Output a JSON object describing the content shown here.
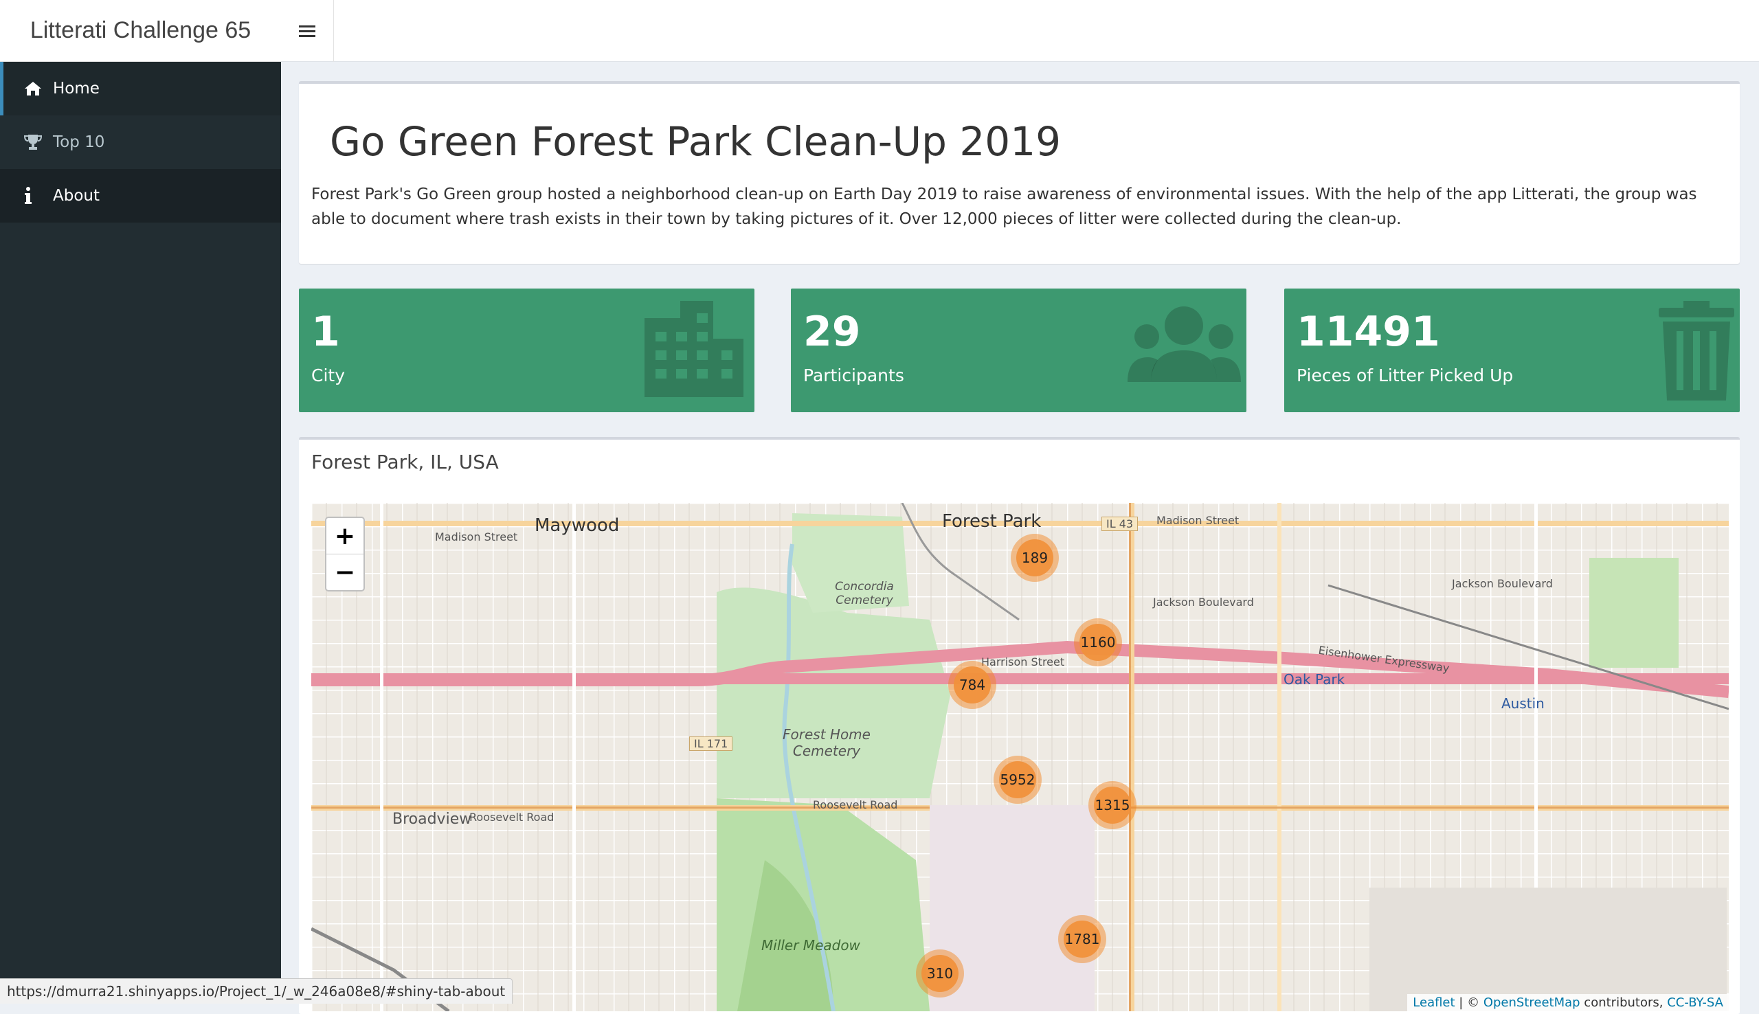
{
  "header": {
    "title": "Litterati Challenge 65",
    "menu_icon": "hamburger-icon"
  },
  "sidebar": {
    "items": [
      {
        "label": "Home",
        "icon": "home-icon"
      },
      {
        "label": "Top 10",
        "icon": "trophy-icon"
      },
      {
        "label": "About",
        "icon": "info-icon"
      }
    ]
  },
  "intro": {
    "title": "Go Green Forest Park Clean-Up 2019",
    "text": "Forest Park's Go Green group hosted a neighborhood clean-up on Earth Day 2019 to raise awareness of environmental issues. With the help of the app Litterati, the group was able to document where trash exists in their town by taking pictures of it. Over 12,000 pieces of litter were collected during the clean-up."
  },
  "value_boxes": [
    {
      "value": "1",
      "label": "City",
      "icon": "building-icon"
    },
    {
      "value": "29",
      "label": "Participants",
      "icon": "users-icon"
    },
    {
      "value": "11491",
      "label": "Pieces of Litter Picked Up",
      "icon": "trash-icon"
    }
  ],
  "colors": {
    "value_box": "#3d9970",
    "sidebar": "#222d32",
    "cluster": "#f0913c"
  },
  "map": {
    "title": "Forest Park, IL, USA",
    "zoom_in": "+",
    "zoom_out": "−",
    "labels": {
      "maywood": "Maywood",
      "forest_park": "Forest Park",
      "broadview": "Broadview",
      "oak_park": "Oak Park",
      "austin": "Austin",
      "forest_home": "Forest Home Cemetery",
      "concordia": "Concordia Cemetery",
      "miller_meadow": "Miller Meadow",
      "madison": "Madison Street",
      "jackson": "Jackson Boulevard",
      "roosevelt": "Roosevelt Road",
      "eisenhower": "Eisenhower Expressway",
      "harrison": "Harrison Street",
      "il171": "IL 171",
      "il43": "IL 43"
    },
    "clusters": [
      "189",
      "1160",
      "784",
      "5952",
      "1315",
      "1781",
      "310"
    ],
    "attribution": {
      "leaflet": "Leaflet",
      "sep": " | © ",
      "osm": "OpenStreetMap",
      "contrib": " contributors, ",
      "license": "CC-BY-SA"
    }
  },
  "status_bar": {
    "url": "https://dmurra21.shinyapps.io/Project_1/_w_246a08e8/#shiny-tab-about"
  }
}
